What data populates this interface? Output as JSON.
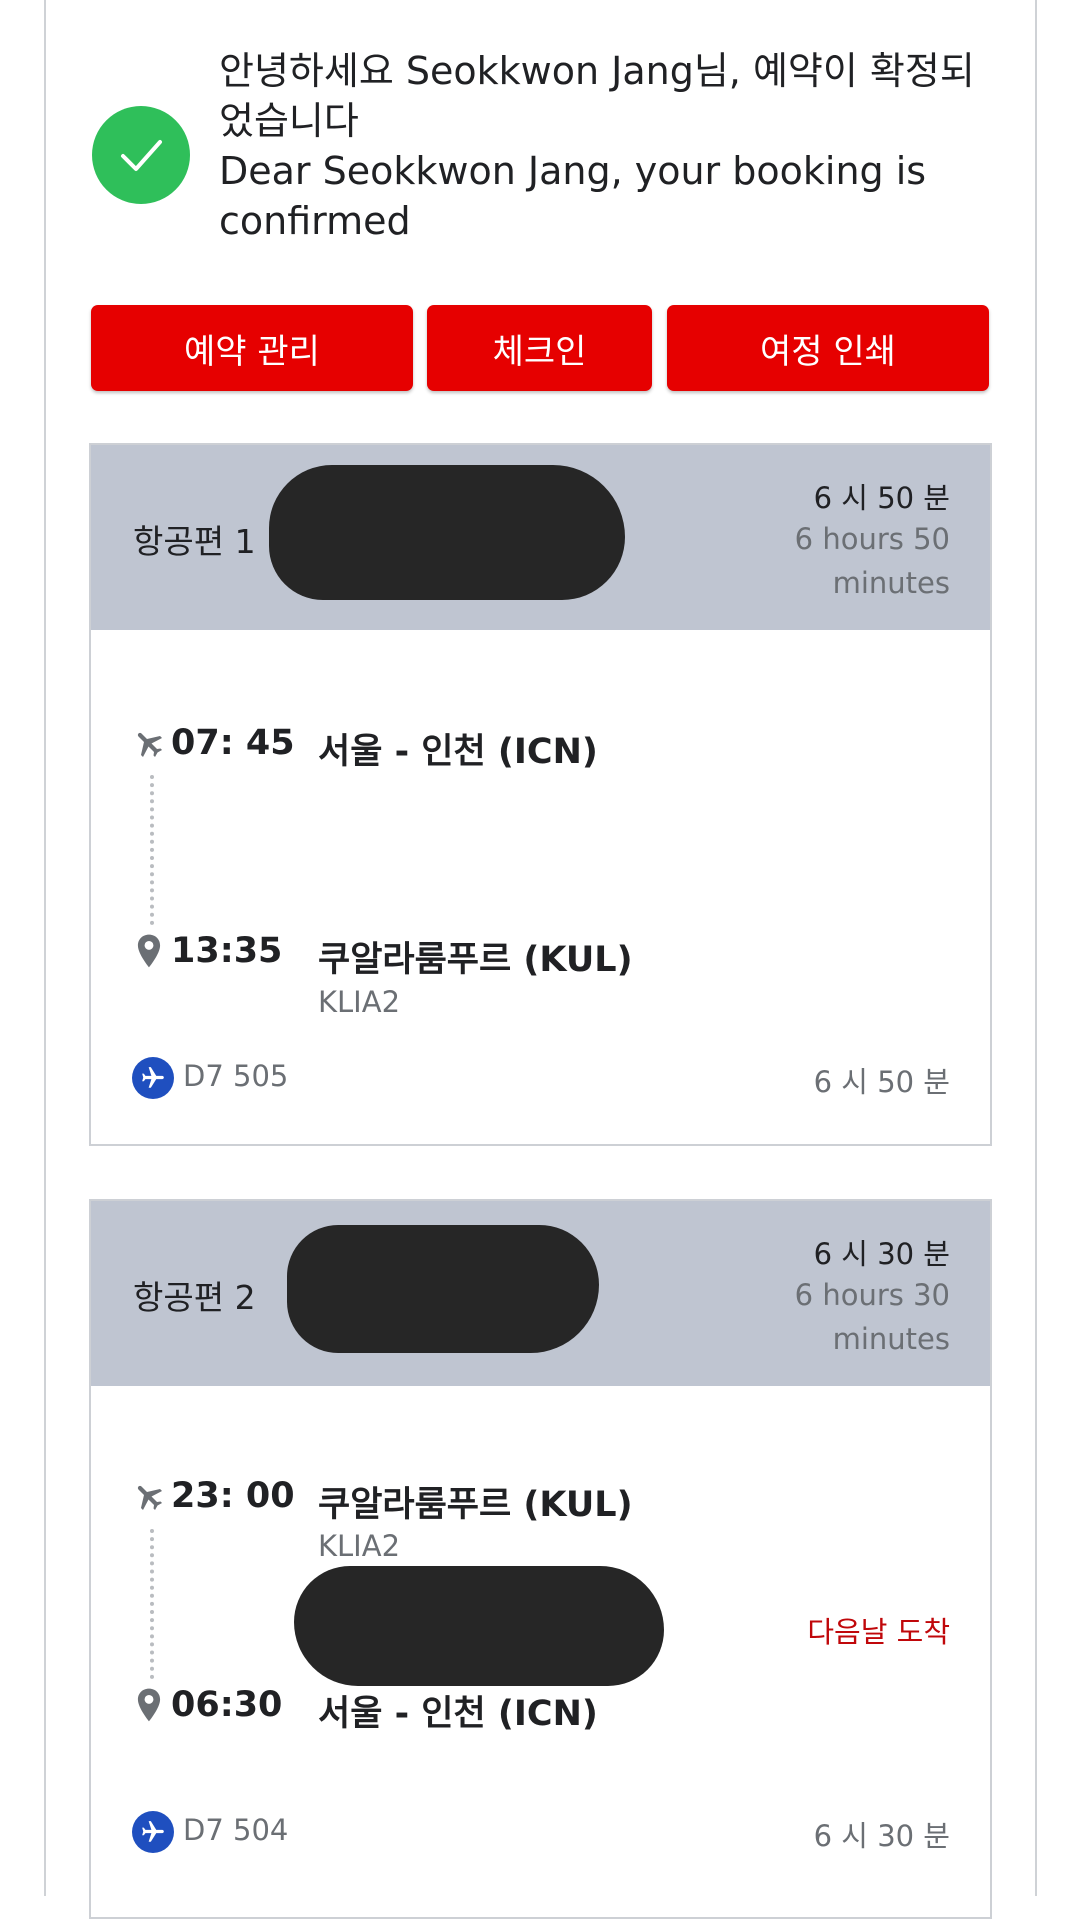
{
  "greeting": {
    "line_ko": "안녕하세요 Seokkwon Jang님, 예약이 확정되었습니다",
    "line_en": "Dear Seokkwon Jang, your booking is confirmed",
    "icon": "check-icon",
    "icon_color": "#2fbf5a"
  },
  "actions": {
    "manage_label": "예약 관리",
    "checkin_label": "체크인",
    "print_label": "여정 인쇄",
    "color": "#e60000"
  },
  "flights": [
    {
      "title": "항공편 1",
      "duration_ko": "6 시 50 분",
      "duration_en": "6 hours 50 minutes",
      "departure": {
        "time": "07: 45",
        "place": "서울 - 인천 (ICN)",
        "terminal": ""
      },
      "arrival": {
        "time": "13:35",
        "place": "쿠알라룸푸르 (KUL)",
        "terminal": "KLIA2"
      },
      "flight_number": "D7 505",
      "footer_duration": "6 시 50 분",
      "next_day_note": ""
    },
    {
      "title": "항공편 2",
      "duration_ko": "6 시 30 분",
      "duration_en": "6 hours 30 minutes",
      "departure": {
        "time": "23: 00",
        "place": "쿠알라룸푸르 (KUL)",
        "terminal": "KLIA2"
      },
      "arrival": {
        "time": "06:30",
        "place": "서울 - 인천 (ICN)",
        "terminal": ""
      },
      "flight_number": "D7 504",
      "footer_duration": "6 시 30 분",
      "next_day_note": "다음날 도착"
    }
  ]
}
